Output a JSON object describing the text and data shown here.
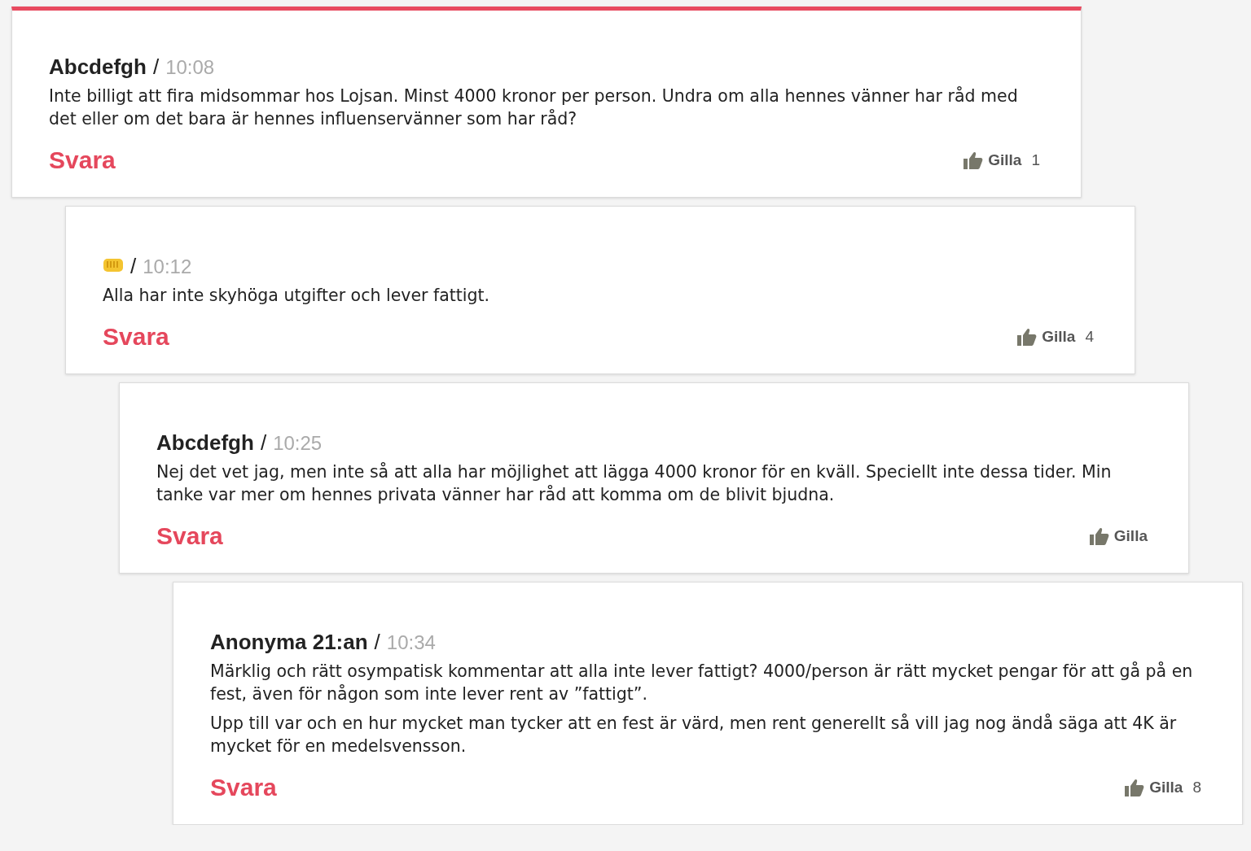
{
  "comments": [
    {
      "kind": "name",
      "author": "Abcdefgh",
      "time": "10:08",
      "highlighted": true,
      "paragraphs": [
        "Inte billigt att fira midsommar hos Lojsan. Minst 4000 kronor per person. Undra om alla hennes vänner har råd med det eller om det bara är hennes influenservänner som har råd?"
      ],
      "reply": "Svara",
      "like": "Gilla",
      "likes": "1",
      "separator": "/",
      "children": [
        {
          "kind": "icon",
          "time": "10:12",
          "highlighted": false,
          "paragraphs": [
            "Alla har inte skyhöga utgifter och lever fattigt."
          ],
          "reply": "Svara",
          "like": "Gilla",
          "likes": "4",
          "separator": "/",
          "children": [
            {
              "kind": "name",
              "author": "Abcdefgh",
              "time": "10:25",
              "highlighted": false,
              "paragraphs": [
                "Nej det vet jag, men inte så att alla har möjlighet att lägga 4000 kronor för en kväll. Speciellt inte dessa tider. Min tanke var mer om hennes privata vänner har råd att komma om de blivit bjudna."
              ],
              "reply": "Svara",
              "like": "Gilla",
              "separator": "/",
              "children": [
                {
                  "kind": "name",
                  "author": "Anonyma 21:an",
                  "time": "10:34",
                  "highlighted": false,
                  "paragraphs": [
                    "Märklig och rätt osympatisk kommentar att alla inte lever fattigt? 4000/person är rätt mycket pengar för att gå på en fest, även för någon som inte lever rent av ”fattigt”.",
                    "Upp till var och en hur mycket man tycker att en fest är värd, men rent generellt så vill jag nog ändå säga att 4K är mycket för en medelsvensson."
                  ],
                  "reply": "Svara",
                  "like": "Gilla",
                  "likes": "8",
                  "separator": "/"
                }
              ]
            }
          ]
        }
      ]
    }
  ]
}
